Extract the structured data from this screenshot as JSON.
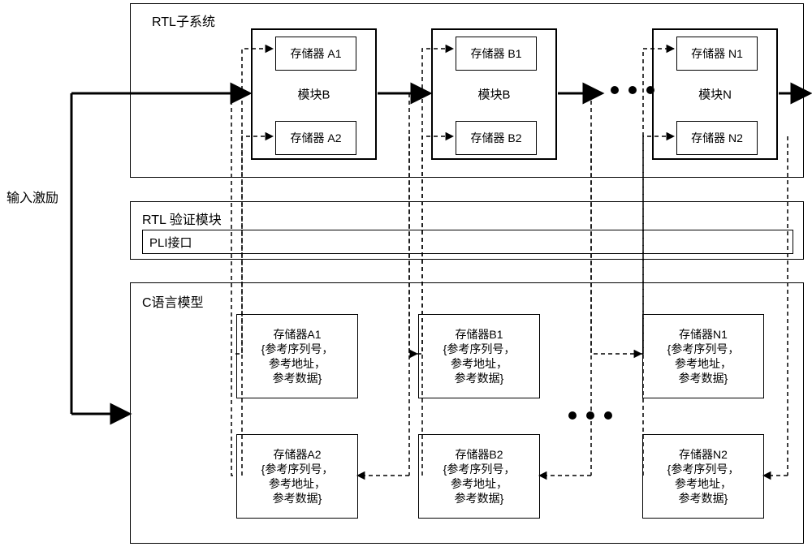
{
  "input_label": "输入激励",
  "rtl_subsystem": {
    "title": "RTL子系统",
    "modules": [
      {
        "name": "模块B",
        "mem_top": "存储器\nA1",
        "mem_bot": "存储器\nA2"
      },
      {
        "name": "模块B",
        "mem_top": "存储器\nB1",
        "mem_bot": "存储器\nB2"
      },
      {
        "name": "模块N",
        "mem_top": "存储器\nN1",
        "mem_bot": "存储器\nN2"
      }
    ]
  },
  "rtl_verify": {
    "title": "RTL 验证模块",
    "pli": "PLI接口"
  },
  "c_model": {
    "title": "C语言模型",
    "boxes": [
      {
        "t": "存储器A1\n{参考序列号，\n参考地址，\n参考数据}"
      },
      {
        "t": "存储器B1\n{参考序列号，\n参考地址，\n参考数据}"
      },
      {
        "t": "存储器N1\n{参考序列号，\n参考地址，\n参考数据}"
      },
      {
        "t": "存储器A2\n{参考序列号，\n参考地址，\n参考数据}"
      },
      {
        "t": "存储器B2\n{参考序列号，\n参考地址，\n参考数据}"
      },
      {
        "t": "存储器N2\n{参考序列号，\n参考地址，\n参考数据}"
      }
    ]
  }
}
